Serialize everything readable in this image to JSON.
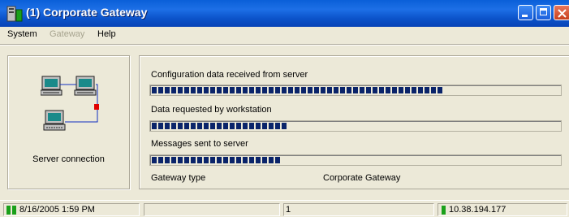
{
  "window": {
    "title": "(1) Corporate Gateway"
  },
  "menu": {
    "system": "System",
    "gateway": "Gateway",
    "help": "Help"
  },
  "connection": {
    "label": "Server connection"
  },
  "progress": [
    {
      "label": "Configuration data received from server",
      "fill_fraction": 0.72
    },
    {
      "label": "Data requested by workstation",
      "fill_fraction": 0.34
    },
    {
      "label": "Messages sent to server",
      "fill_fraction": 0.32
    }
  ],
  "info": {
    "gateway_type_label": "Gateway type",
    "gateway_type_value": "Corporate Gateway"
  },
  "status": {
    "datetime": "8/16/2005 1:59 PM",
    "count": "1",
    "ip": "10.38.194.177"
  },
  "colors": {
    "title_bar": "#0b52c9",
    "progress_block": "#0a246a",
    "status_indicator": "#1aa01a",
    "window_bg": "#ece9d8"
  }
}
